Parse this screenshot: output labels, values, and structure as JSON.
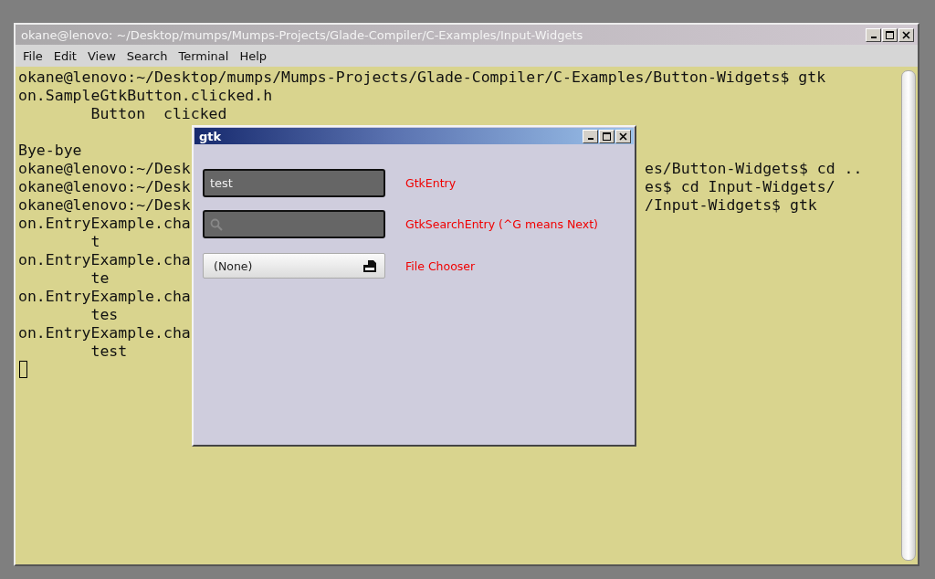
{
  "window": {
    "title": "okane@lenovo: ~/Desktop/mumps/Mumps-Projects/Glade-Compiler/C-Examples/Input-Widgets"
  },
  "menu": [
    "File",
    "Edit",
    "View",
    "Search",
    "Terminal",
    "Help"
  ],
  "terminal_lines": [
    {
      "left": "okane@lenovo:~/Desktop/mumps/Mumps-Projects/Glade-Compiler/C-Examples/Button-Widgets$ gtk"
    },
    {
      "left": "on.SampleGtkButton.clicked.h"
    },
    {
      "left": "        Button  clicked"
    },
    {
      "left": "Bye-bye",
      "blank_before": true
    },
    {
      "left": "okane@lenovo:~/Desk",
      "right": "es/Button-Widgets$ cd .."
    },
    {
      "left": "okane@lenovo:~/Desk",
      "right": "es$ cd Input-Widgets/"
    },
    {
      "left": "okane@lenovo:~/Desk",
      "right": "/Input-Widgets$ gtk"
    },
    {
      "left": "on.EntryExample.cha"
    },
    {
      "left": "        t"
    },
    {
      "left": "on.EntryExample.cha"
    },
    {
      "left": "        te"
    },
    {
      "left": "on.EntryExample.cha"
    },
    {
      "left": "        tes"
    },
    {
      "left": "on.EntryExample.cha"
    },
    {
      "left": "        test"
    }
  ],
  "dialog": {
    "title": "gtk",
    "rows": [
      {
        "kind": "entry",
        "value": "test",
        "label": "GtkEntry"
      },
      {
        "kind": "search",
        "label": "GtkSearchEntry (^G means Next)"
      },
      {
        "kind": "file",
        "value": "(None)",
        "label": "File Chooser"
      }
    ]
  }
}
